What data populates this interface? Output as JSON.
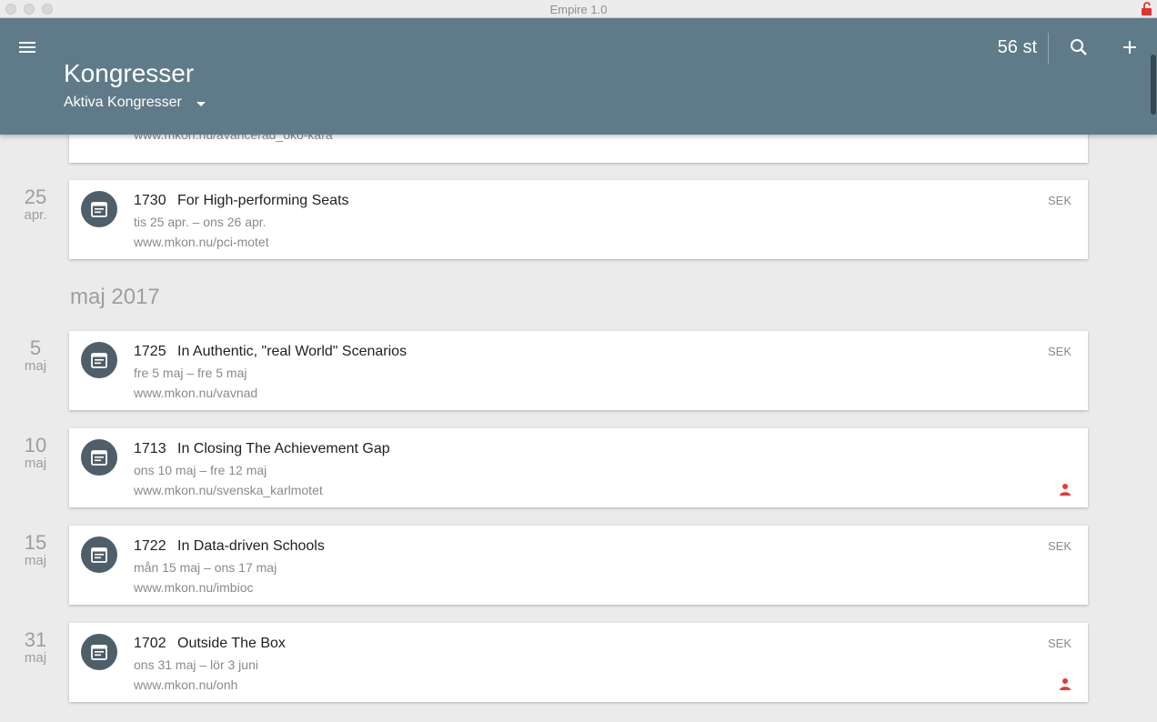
{
  "window": {
    "title": "Empire 1.0"
  },
  "header": {
    "title": "Kongresser",
    "filter_label": "Aktiva Kongresser",
    "count": "56 st",
    "bg_color": "#5f7b89"
  },
  "icons": {
    "menu": "menu-icon",
    "search": "search-icon",
    "add": "plus-icon",
    "event": "calendar-icon",
    "person": "person-icon",
    "lock": "lock-icon"
  },
  "top_partial": {
    "url": "www.mkon.nu/avancerad_oko-kara"
  },
  "month_heading": "maj 2017",
  "items": [
    {
      "day": "25",
      "month": "apr.",
      "id": "1730",
      "name": "For High-performing Seats",
      "dates": "tis 25 apr. – ons 26 apr.",
      "url": "www.mkon.nu/pci-motet",
      "currency": "SEK",
      "has_person": false
    },
    {
      "day": "5",
      "month": "maj",
      "id": "1725",
      "name": "In Authentic, \"real World\" Scenarios",
      "dates": "fre 5 maj – fre 5 maj",
      "url": "www.mkon.nu/vavnad",
      "currency": "SEK",
      "has_person": false
    },
    {
      "day": "10",
      "month": "maj",
      "id": "1713",
      "name": "In Closing The Achievement Gap",
      "dates": "ons 10 maj – fre 12 maj",
      "url": "www.mkon.nu/svenska_karlmotet",
      "currency": "",
      "has_person": true
    },
    {
      "day": "15",
      "month": "maj",
      "id": "1722",
      "name": "In Data-driven Schools",
      "dates": "mån 15 maj – ons 17 maj",
      "url": "www.mkon.nu/imbioc",
      "currency": "SEK",
      "has_person": false
    },
    {
      "day": "31",
      "month": "maj",
      "id": "1702",
      "name": "Outside The Box",
      "dates": "ons 31 maj – lör 3 juni",
      "url": "www.mkon.nu/onh",
      "currency": "SEK",
      "has_person": true
    }
  ]
}
